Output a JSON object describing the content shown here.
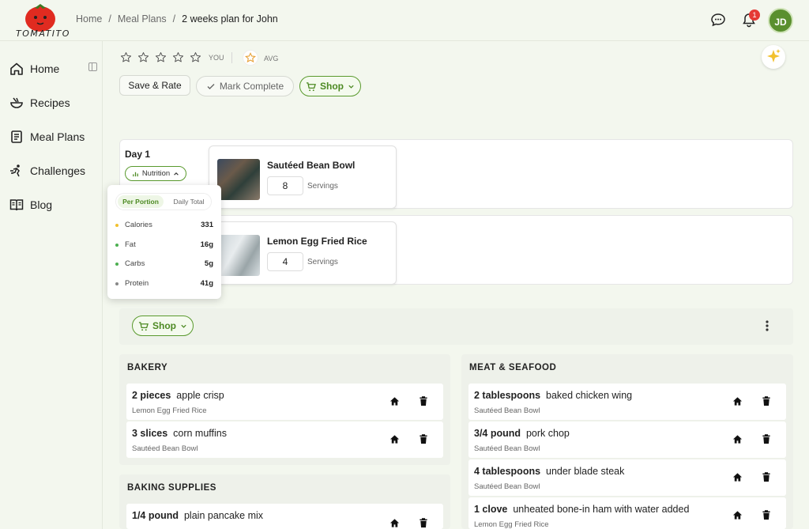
{
  "header": {
    "logo_text": "TOMATITO",
    "breadcrumbs": [
      "Home",
      "Meal Plans",
      "2 weeks plan for John"
    ],
    "notification_count": "1",
    "avatar_initials": "JD"
  },
  "sidebar": {
    "items": [
      {
        "label": "Home",
        "icon": "home-icon"
      },
      {
        "label": "Recipes",
        "icon": "bowl-icon"
      },
      {
        "label": "Meal Plans",
        "icon": "list-icon"
      },
      {
        "label": "Challenges",
        "icon": "runner-icon"
      },
      {
        "label": "Blog",
        "icon": "book-icon"
      }
    ]
  },
  "rating": {
    "you_label": "YOU",
    "avg_label": "AVG",
    "stars": 5
  },
  "actions": {
    "save_label": "Save & Rate",
    "mark_label": "Mark Complete",
    "shop_label": "Shop"
  },
  "plan": {
    "day_label": "Day 1",
    "nutrition_label": "Nutrition",
    "meals": [
      {
        "name": "Sautéed Bean Bowl",
        "servings": "8",
        "servings_label": "Servings"
      },
      {
        "name": "Lemon Egg Fried Rice",
        "servings": "4",
        "servings_label": "Servings"
      }
    ]
  },
  "nutrition_popover": {
    "tabs": [
      "Per Portion",
      "Daily Total"
    ],
    "rows": [
      {
        "label": "Calories",
        "value": "331",
        "color": "#f2c12e"
      },
      {
        "label": "Fat",
        "value": "16g",
        "color": "#4caf50"
      },
      {
        "label": "Carbs",
        "value": "5g",
        "color": "#4caf50"
      },
      {
        "label": "Protein",
        "value": "41g",
        "color": "#888888"
      }
    ]
  },
  "shopping": {
    "shop_label": "Shop",
    "categories": [
      {
        "name": "BAKERY",
        "items": [
          {
            "qty": "2 pieces",
            "name": "apple crisp",
            "source": "Lemon Egg Fried Rice"
          },
          {
            "qty": "3 slices",
            "name": "corn muffins",
            "source": "Sautéed Bean Bowl"
          }
        ]
      },
      {
        "name": "BAKING SUPPLIES",
        "items": [
          {
            "qty": "1/4 pound",
            "name": "plain pancake mix",
            "source": ""
          }
        ]
      },
      {
        "name": "MEAT & SEAFOOD",
        "items": [
          {
            "qty": "2 tablespoons",
            "name": "baked chicken wing",
            "source": "Sautéed Bean Bowl"
          },
          {
            "qty": "3/4 pound",
            "name": "pork chop",
            "source": "Sautéed Bean Bowl"
          },
          {
            "qty": "4 tablespoons",
            "name": "under blade steak",
            "source": "Sautéed Bean Bowl"
          },
          {
            "qty": "1 clove",
            "name": "unheated bone-in ham with water added",
            "source": "Lemon Egg Fried Rice"
          }
        ]
      }
    ]
  },
  "colors": {
    "accent": "#5a9a2e",
    "background": "#f3f7ee",
    "badge": "#e53935"
  }
}
